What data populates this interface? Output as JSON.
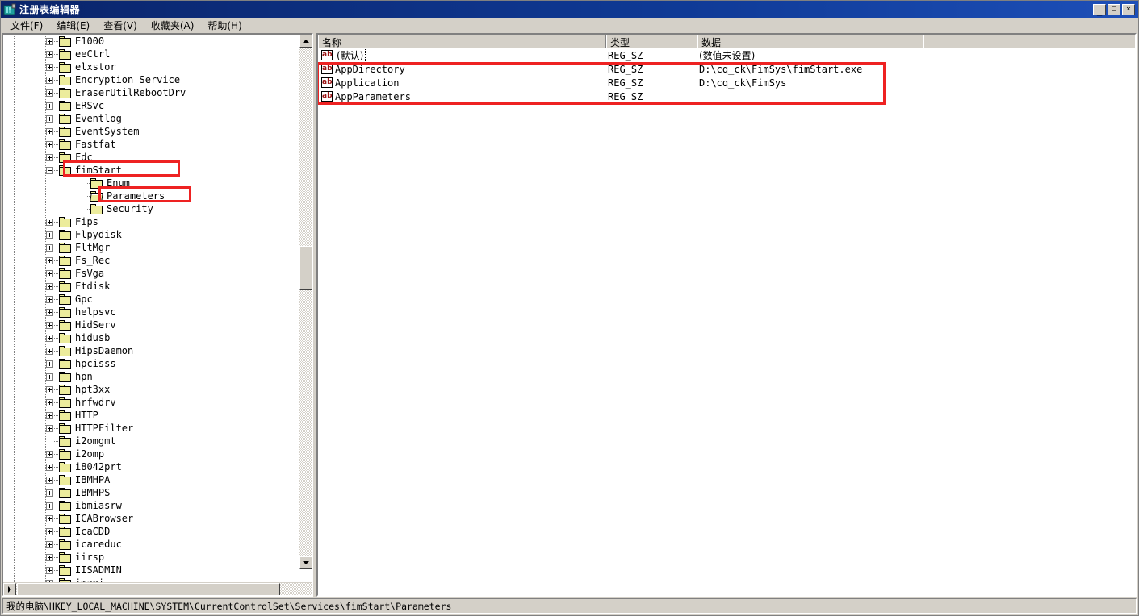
{
  "window": {
    "title": "注册表编辑器",
    "icon": "registry-editor-icon",
    "minimize_label": "_",
    "maximize_label": "□",
    "close_label": "✕"
  },
  "menu": {
    "items": [
      {
        "label": "文件(F)",
        "name": "file"
      },
      {
        "label": "编辑(E)",
        "name": "edit"
      },
      {
        "label": "查看(V)",
        "name": "view"
      },
      {
        "label": "收藏夹(A)",
        "name": "favorites"
      },
      {
        "label": "帮助(H)",
        "name": "help"
      }
    ]
  },
  "tree": {
    "nodes": [
      {
        "label": "E1000",
        "indent": 2,
        "expander": "plus",
        "icon": "folder-icon"
      },
      {
        "label": "eeCtrl",
        "indent": 2,
        "expander": "plus",
        "icon": "folder-icon"
      },
      {
        "label": "elxstor",
        "indent": 2,
        "expander": "plus",
        "icon": "folder-icon"
      },
      {
        "label": "Encryption Service",
        "indent": 2,
        "expander": "plus",
        "icon": "folder-icon"
      },
      {
        "label": "EraserUtilRebootDrv",
        "indent": 2,
        "expander": "plus",
        "icon": "folder-icon"
      },
      {
        "label": "ERSvc",
        "indent": 2,
        "expander": "plus",
        "icon": "folder-icon"
      },
      {
        "label": "Eventlog",
        "indent": 2,
        "expander": "plus",
        "icon": "folder-icon"
      },
      {
        "label": "EventSystem",
        "indent": 2,
        "expander": "plus",
        "icon": "folder-icon"
      },
      {
        "label": "Fastfat",
        "indent": 2,
        "expander": "plus",
        "icon": "folder-icon"
      },
      {
        "label": "Fdc",
        "indent": 2,
        "expander": "plus",
        "icon": "folder-icon"
      },
      {
        "label": "fimStart",
        "indent": 2,
        "expander": "minus",
        "icon": "folder-icon",
        "highlighted": true
      },
      {
        "label": "Enum",
        "indent": 3,
        "expander": "none",
        "icon": "folder-icon"
      },
      {
        "label": "Parameters",
        "indent": 3,
        "expander": "none",
        "icon": "folder-open-icon",
        "highlighted": true,
        "selected": true
      },
      {
        "label": "Security",
        "indent": 3,
        "expander": "none",
        "icon": "folder-icon"
      },
      {
        "label": "Fips",
        "indent": 2,
        "expander": "plus",
        "icon": "folder-icon"
      },
      {
        "label": "Flpydisk",
        "indent": 2,
        "expander": "plus",
        "icon": "folder-icon"
      },
      {
        "label": "FltMgr",
        "indent": 2,
        "expander": "plus",
        "icon": "folder-icon"
      },
      {
        "label": "Fs_Rec",
        "indent": 2,
        "expander": "plus",
        "icon": "folder-icon"
      },
      {
        "label": "FsVga",
        "indent": 2,
        "expander": "plus",
        "icon": "folder-icon"
      },
      {
        "label": "Ftdisk",
        "indent": 2,
        "expander": "plus",
        "icon": "folder-icon"
      },
      {
        "label": "Gpc",
        "indent": 2,
        "expander": "plus",
        "icon": "folder-icon"
      },
      {
        "label": "helpsvc",
        "indent": 2,
        "expander": "plus",
        "icon": "folder-icon"
      },
      {
        "label": "HidServ",
        "indent": 2,
        "expander": "plus",
        "icon": "folder-icon"
      },
      {
        "label": "hidusb",
        "indent": 2,
        "expander": "plus",
        "icon": "folder-icon"
      },
      {
        "label": "HipsDaemon",
        "indent": 2,
        "expander": "plus",
        "icon": "folder-icon"
      },
      {
        "label": "hpcisss",
        "indent": 2,
        "expander": "plus",
        "icon": "folder-icon"
      },
      {
        "label": "hpn",
        "indent": 2,
        "expander": "plus",
        "icon": "folder-icon"
      },
      {
        "label": "hpt3xx",
        "indent": 2,
        "expander": "plus",
        "icon": "folder-icon"
      },
      {
        "label": "hrfwdrv",
        "indent": 2,
        "expander": "plus",
        "icon": "folder-icon"
      },
      {
        "label": "HTTP",
        "indent": 2,
        "expander": "plus",
        "icon": "folder-icon"
      },
      {
        "label": "HTTPFilter",
        "indent": 2,
        "expander": "plus",
        "icon": "folder-icon"
      },
      {
        "label": "i2omgmt",
        "indent": 2,
        "expander": "none",
        "icon": "folder-icon"
      },
      {
        "label": "i2omp",
        "indent": 2,
        "expander": "plus",
        "icon": "folder-icon"
      },
      {
        "label": "i8042prt",
        "indent": 2,
        "expander": "plus",
        "icon": "folder-icon"
      },
      {
        "label": "IBMHPA",
        "indent": 2,
        "expander": "plus",
        "icon": "folder-icon"
      },
      {
        "label": "IBMHPS",
        "indent": 2,
        "expander": "plus",
        "icon": "folder-icon"
      },
      {
        "label": "ibmiasrw",
        "indent": 2,
        "expander": "plus",
        "icon": "folder-icon"
      },
      {
        "label": "ICABrowser",
        "indent": 2,
        "expander": "plus",
        "icon": "folder-icon"
      },
      {
        "label": "IcaCDD",
        "indent": 2,
        "expander": "plus",
        "icon": "folder-icon"
      },
      {
        "label": "icareduc",
        "indent": 2,
        "expander": "plus",
        "icon": "folder-icon"
      },
      {
        "label": "iirsp",
        "indent": 2,
        "expander": "plus",
        "icon": "folder-icon"
      },
      {
        "label": "IISADMIN",
        "indent": 2,
        "expander": "plus",
        "icon": "folder-icon"
      },
      {
        "label": "imapi",
        "indent": 2,
        "expander": "plus",
        "icon": "folder-icon"
      }
    ]
  },
  "values": {
    "columns": [
      {
        "label": "名称",
        "name": "name"
      },
      {
        "label": "类型",
        "name": "type"
      },
      {
        "label": "数据",
        "name": "data"
      }
    ],
    "rows": [
      {
        "name": "(默认)",
        "type": "REG_SZ",
        "data": "(数值未设置)",
        "icon": "string-value-icon",
        "focused": true,
        "cjk": true
      },
      {
        "name": "AppDirectory",
        "type": "REG_SZ",
        "data": "D:\\cq_ck\\FimSys\\fimStart.exe",
        "icon": "string-value-icon",
        "focused": false,
        "cjk": false
      },
      {
        "name": "Application",
        "type": "REG_SZ",
        "data": "D:\\cq_ck\\FimSys",
        "icon": "string-value-icon",
        "focused": false,
        "cjk": false
      },
      {
        "name": "AppParameters",
        "type": "REG_SZ",
        "data": "",
        "icon": "string-value-icon",
        "focused": false,
        "cjk": false
      }
    ]
  },
  "statusbar": {
    "path": "我的电脑\\HKEY_LOCAL_MACHINE\\SYSTEM\\CurrentControlSet\\Services\\fimStart\\Parameters"
  },
  "colors": {
    "annotation": "#ee2222",
    "titlebar": "#0a246a",
    "chrome": "#d4d0c8",
    "folder": "#ecec9c",
    "value_icon_text": "#9b1515"
  }
}
